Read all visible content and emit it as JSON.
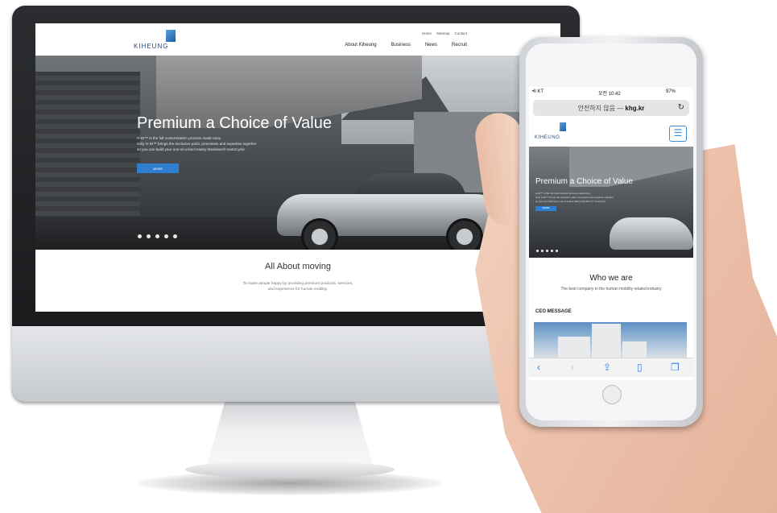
{
  "desktop": {
    "logo_text": "KIHEUNG",
    "util_nav": [
      "Home",
      "Sitemap",
      "Contact"
    ],
    "main_nav": [
      "About Kiheung",
      "Business",
      "News",
      "Recruit"
    ],
    "hero": {
      "title": "Premium a Choice of Value",
      "lines": [
        "H-DI™ is the full customization process made easy.",
        "Only H-DI™ brings the exclusive parts, processes and expertise together",
        "so you can build your one-of-a-kind Harley-Davidson® motorcycle."
      ],
      "button_label": "MORE",
      "slide_count": 5
    },
    "about": {
      "title": "All About moving",
      "lines": [
        "To make people happy by providing premium products, services,",
        "and experience for human mobility."
      ]
    }
  },
  "phone": {
    "status": {
      "carrier": "•ll KT",
      "time": "오전 10:42",
      "battery": "97%"
    },
    "url": {
      "prefix": "안전하지 않음 — ",
      "domain": "khg.kr"
    },
    "logo_text": "KIHEUNG",
    "hero": {
      "title": "Premium a Choice of Value",
      "button_label": "MORE"
    },
    "who_title": "Who we are",
    "who_subtitle": "The best company in the human mobility related industry",
    "ceo_label": "CEO MESSAGE"
  },
  "colors": {
    "accent": "#2f7fd1",
    "brand": "#2a4d7a"
  }
}
